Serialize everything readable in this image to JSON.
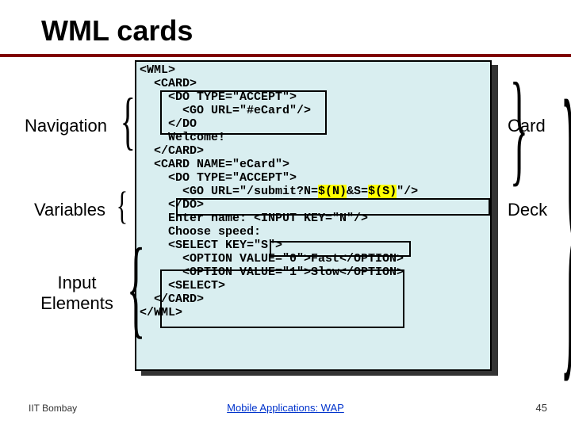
{
  "title": "WML cards",
  "labels": {
    "navigation": "Navigation",
    "variables": "Variables",
    "input": "Input\nElements",
    "card": "Card",
    "deck": "Deck"
  },
  "code": {
    "l01": "<WML>",
    "l02": "<CARD>",
    "l03": "<DO TYPE=\"ACCEPT\">",
    "l04": "<GO URL=\"#eCard\"/>",
    "l05": "</DO",
    "l06": "Welcome!",
    "l07": "</CARD>",
    "l08": "<CARD NAME=\"eCard\">",
    "l09": "<DO TYPE=\"ACCEPT\">",
    "l10a": "<GO URL=\"/submit?N=",
    "l10b": "$(N)",
    "l10c": "&S=",
    "l10d": "$(S)",
    "l10e": "\"/>",
    "l11": "</DO>",
    "l12a": "Enter name: ",
    "l12b": "<INPUT KEY=\"N\"/>",
    "l13": "Choose speed:",
    "l14": "<SELECT KEY=\"S\">",
    "l15": "<OPTION VALUE=\"0\">Fast</OPTION>",
    "l16": "<OPTION VALUE=\"1\">Slow</OPTION>",
    "l17": "<SELECT>",
    "l18": "</CARD>",
    "l19": "</WML>"
  },
  "footer": {
    "left": "IIT Bombay",
    "center": "Mobile Applications: WAP",
    "right": "45"
  }
}
